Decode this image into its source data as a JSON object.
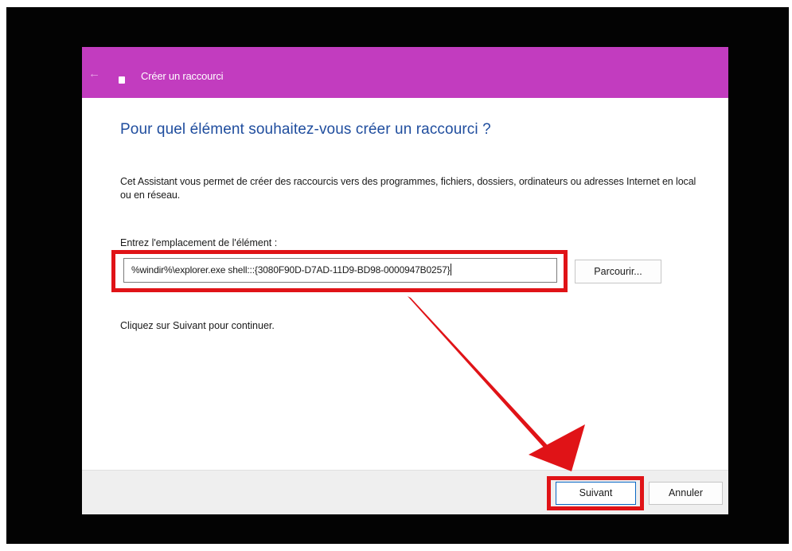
{
  "window": {
    "back_glyph": "←",
    "title": "Créer un raccourci",
    "app_icon": "shortcut-icon"
  },
  "wizard": {
    "heading": "Pour quel élément souhaitez-vous créer un raccourci ?",
    "description": "Cet Assistant vous permet de créer des raccourcis vers des programmes, fichiers, dossiers, ordinateurs ou adresses Internet en local ou en réseau.",
    "location_label": "Entrez l'emplacement de l'élément :",
    "location_value": "%windir%\\explorer.exe shell:::{3080F90D-D7AD-11D9-BD98-0000947B0257}",
    "browse_label": "Parcourir...",
    "continue_hint": "Cliquez sur Suivant pour continuer."
  },
  "buttons": {
    "next_label": "Suivant",
    "cancel_label": "Annuler"
  },
  "colors": {
    "titlebar": "#c23cbf",
    "heading": "#1f4d9e",
    "highlight": "#e01317",
    "background": "#030303"
  }
}
